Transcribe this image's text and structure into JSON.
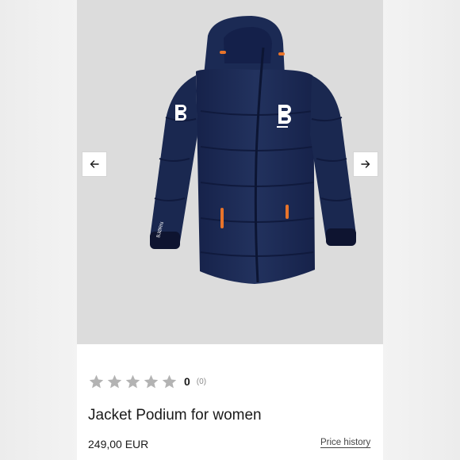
{
  "gallery": {
    "image_name": "jacket-image",
    "brand_mark": "B",
    "sleeve_text": "BJØRN",
    "prev_icon": "arrow-left-icon",
    "next_icon": "arrow-right-icon"
  },
  "product": {
    "rating": {
      "stars_total": 5,
      "stars_filled": 0,
      "value": "0",
      "count": "(0)",
      "star_color": "#b3b3b3"
    },
    "title": "Jacket Podium for women",
    "price": "249,00 EUR",
    "price_history_label": "Price history"
  },
  "colors": {
    "jacket": "#1c2b52",
    "accent_orange": "#e8742a",
    "gallery_bg": "#dcdcdc"
  }
}
